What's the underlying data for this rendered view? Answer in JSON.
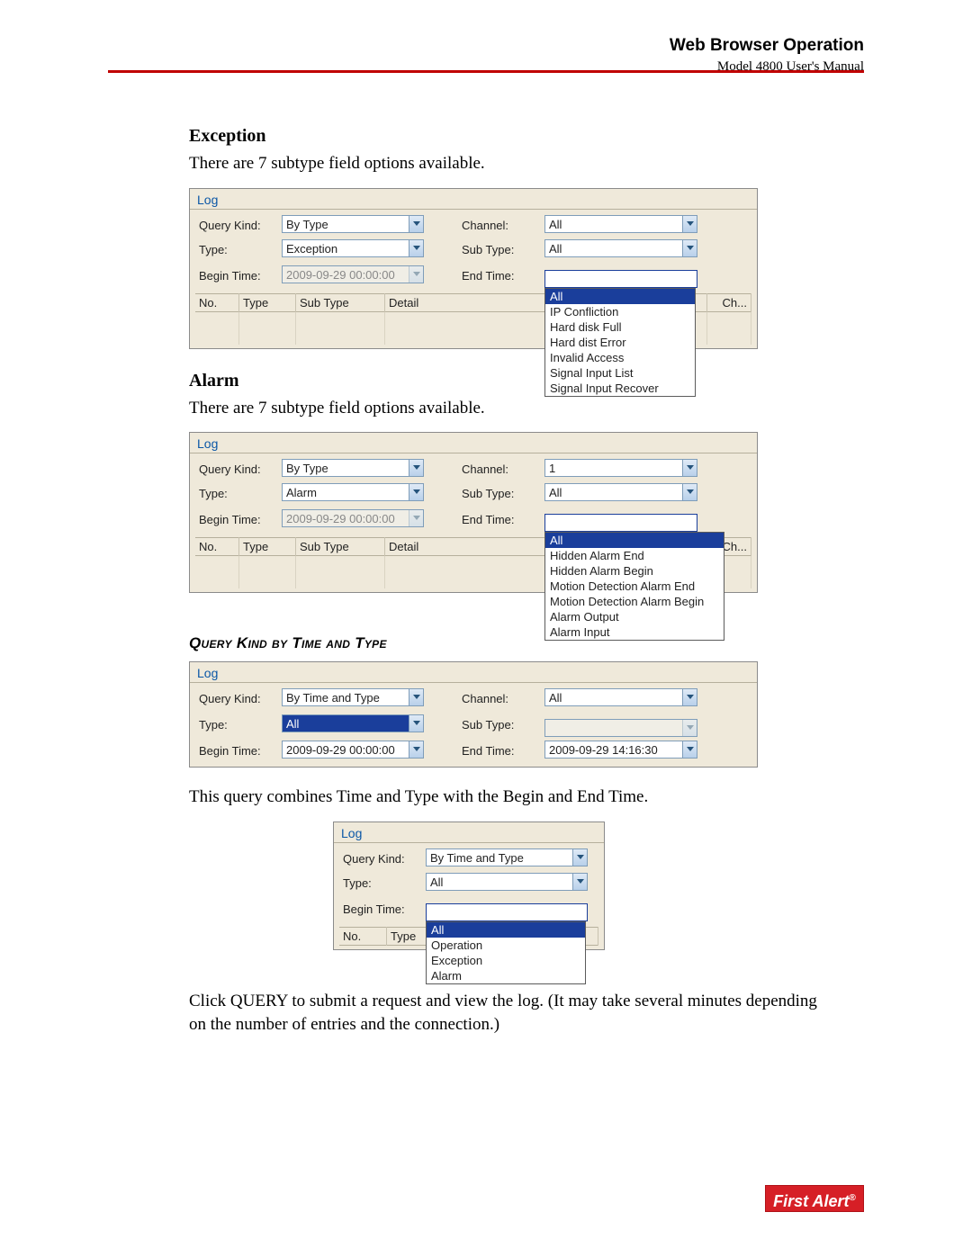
{
  "header": {
    "title": "Web Browser Operation",
    "subtitle": "Model 4800 User's Manual"
  },
  "sections": {
    "exception": {
      "heading": "Exception",
      "intro": "There are 7 subtype field options available.",
      "panel_title": "Log",
      "labels": {
        "query_kind": "Query Kind:",
        "channel": "Channel:",
        "type": "Type:",
        "sub_type": "Sub Type:",
        "begin_time": "Begin Time:",
        "end_time": "End Time:"
      },
      "values": {
        "query_kind": "By Type",
        "channel": "All",
        "type": "Exception",
        "sub_type": "All",
        "begin_time": "2009-09-29 00:00:00"
      },
      "dropdown": [
        "All",
        "IP Confliction",
        "Hard disk Full",
        "Hard dist Error",
        "Invalid Access",
        "Signal Input List",
        "Signal Input Recover"
      ],
      "cols": {
        "no": "No.",
        "type": "Type",
        "sub_type": "Sub Type",
        "detail": "Detail",
        "ch": "Ch..."
      }
    },
    "alarm": {
      "heading": "Alarm",
      "intro": "There are 7 subtype field options available.",
      "panel_title": "Log",
      "labels": {
        "query_kind": "Query Kind:",
        "channel": "Channel:",
        "type": "Type:",
        "sub_type": "Sub Type:",
        "begin_time": "Begin Time:",
        "end_time": "End Time:"
      },
      "values": {
        "query_kind": "By Type",
        "channel": "1",
        "type": "Alarm",
        "sub_type": "All",
        "begin_time": "2009-09-29 00:00:00"
      },
      "dropdown": [
        "All",
        "Hidden Alarm End",
        "Hidden Alarm Begin",
        "Motion Detection Alarm End",
        "Motion Detection Alarm Begin",
        "Alarm Output",
        "Alarm Input"
      ],
      "cols": {
        "no": "No.",
        "type": "Type",
        "sub_type": "Sub Type",
        "detail": "Detail",
        "ch": "Ch..."
      }
    },
    "time_type": {
      "heading": "Query Kind by Time and Type",
      "panel_title": "Log",
      "labels": {
        "query_kind": "Query Kind:",
        "channel": "Channel:",
        "type": "Type:",
        "sub_type": "Sub Type:",
        "begin_time": "Begin Time:",
        "end_time": "End Time:"
      },
      "values": {
        "query_kind": "By Time and Type",
        "channel": "All",
        "type": "All",
        "sub_type": "",
        "begin_time": "2009-09-29 00:00:00",
        "end_time": "2009-09-29 14:16:30"
      },
      "after_text": "This query combines Time and Type with the Begin and End Time."
    },
    "type_drop_panel": {
      "panel_title": "Log",
      "labels": {
        "query_kind": "Query Kind:",
        "type": "Type:",
        "begin_time": "Begin Time:"
      },
      "values": {
        "query_kind": "By Time and Type",
        "type": "All"
      },
      "dropdown": [
        "All",
        "Operation",
        "Exception",
        "Alarm"
      ],
      "cols": {
        "no": "No.",
        "type": "Type"
      }
    },
    "footer_text": "Click QUERY to submit a request and view the log. (It may take several minutes depending on the number of entries and the connection.)"
  },
  "logo": "First Alert"
}
